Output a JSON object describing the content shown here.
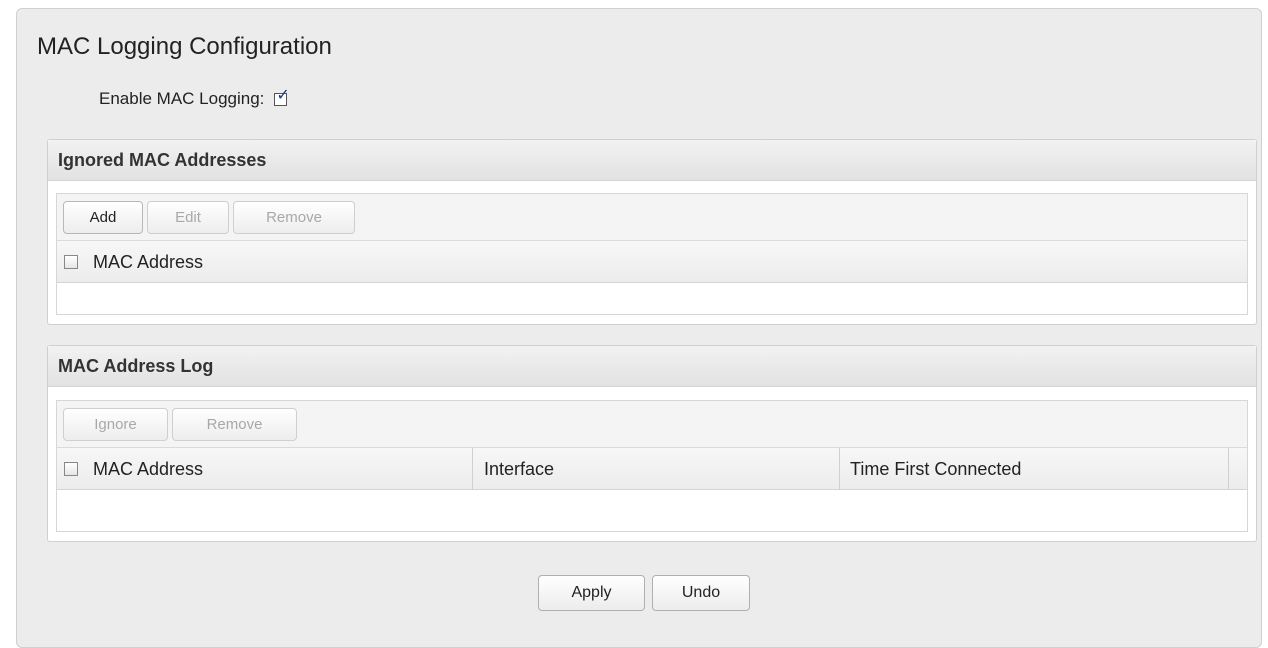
{
  "page": {
    "title": "MAC Logging Configuration",
    "enable_label": "Enable MAC Logging:",
    "enable_checked": true
  },
  "ignored": {
    "header": "Ignored MAC Addresses",
    "buttons": {
      "add": "Add",
      "edit": "Edit",
      "remove": "Remove"
    },
    "columns": [
      "MAC Address"
    ],
    "rows": []
  },
  "log": {
    "header": "MAC Address Log",
    "buttons": {
      "ignore": "Ignore",
      "remove": "Remove"
    },
    "columns": [
      "MAC Address",
      "Interface",
      "Time First Connected"
    ],
    "rows": []
  },
  "actions": {
    "apply": "Apply",
    "undo": "Undo"
  }
}
